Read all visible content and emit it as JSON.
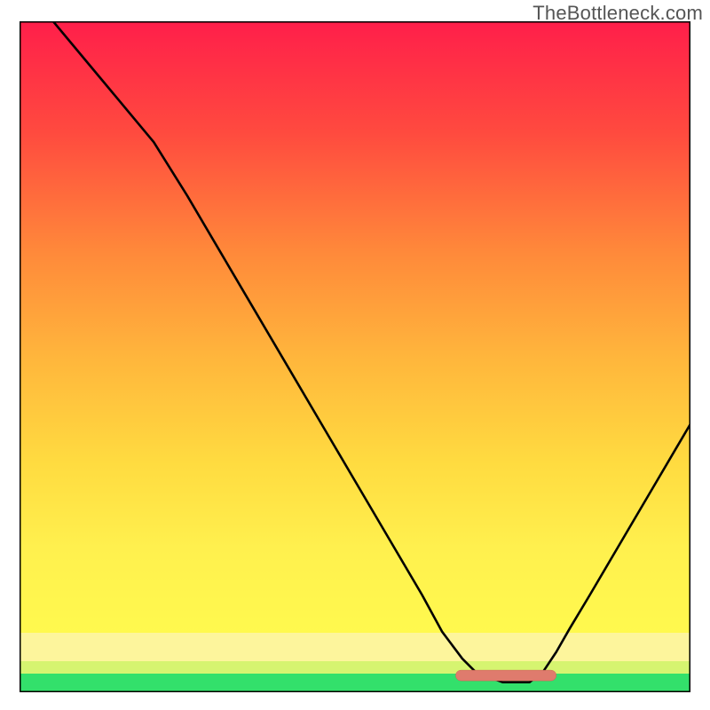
{
  "attribution": "TheBottleneck.com",
  "colors": {
    "gradient_top": "#ff1f4a",
    "gradient_mid_upper": "#ff6a3c",
    "gradient_mid": "#ffb040",
    "gradient_low_mid": "#ffe24a",
    "gradient_yellow_band": "#fdf59c",
    "gradient_glow_band": "#d6f470",
    "gradient_green": "#33e06b",
    "frame": "#000000",
    "curve": "#000000",
    "pill": "#df7b6d"
  },
  "chart_data": {
    "type": "line",
    "title": "",
    "xlabel": "",
    "ylabel": "",
    "xlim": [
      0,
      100
    ],
    "ylim": [
      0,
      100
    ],
    "x": [
      0,
      5,
      10,
      15,
      20,
      25,
      30,
      35,
      40,
      45,
      50,
      55,
      60,
      63,
      66,
      68,
      72,
      76,
      78,
      80,
      82,
      85,
      90,
      95,
      100
    ],
    "values": [
      106,
      100,
      94,
      88,
      82,
      74,
      65.5,
      57,
      48.5,
      40,
      31.5,
      23,
      14.5,
      9,
      5,
      3,
      1.5,
      1.5,
      3,
      6,
      9.5,
      14.5,
      23,
      31.5,
      40
    ],
    "minimum_marker": {
      "x_start": 65,
      "x_end": 80,
      "y": 2.5
    },
    "notes": "Values above 100 visually clip at the top frame. Axes have no ticks or labels."
  }
}
